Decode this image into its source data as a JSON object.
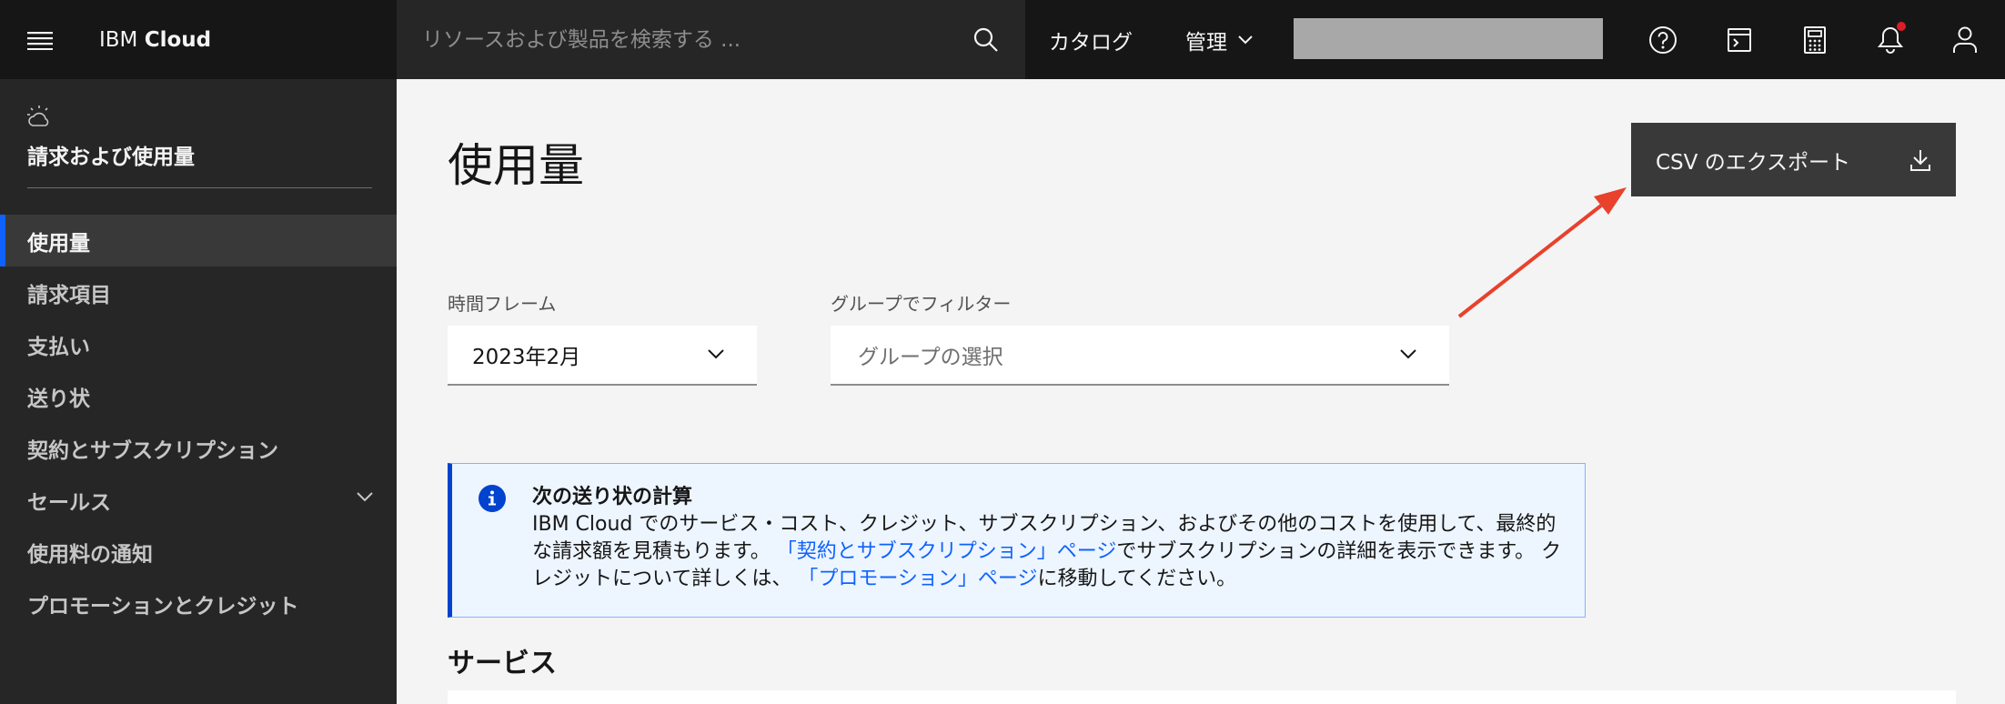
{
  "header": {
    "brand_prefix": "IBM ",
    "brand_strong": "Cloud",
    "search_placeholder": "リソースおよび製品を検索する ...",
    "catalog_label": "カタログ",
    "manage_label": "管理"
  },
  "sidebar": {
    "title": "請求および使用量",
    "items": [
      {
        "label": "使用量",
        "active": true
      },
      {
        "label": "請求項目"
      },
      {
        "label": "支払い"
      },
      {
        "label": "送り状"
      },
      {
        "label": "契約とサブスクリプション"
      },
      {
        "label": "セールス",
        "expandable": true
      },
      {
        "label": "使用料の通知"
      },
      {
        "label": "プロモーションとクレジット"
      }
    ]
  },
  "main": {
    "page_title": "使用量",
    "export_label": "CSV のエクスポート",
    "time_frame_label": "時間フレーム",
    "time_frame_value": "2023年2月",
    "group_filter_label": "グループでフィルター",
    "group_filter_placeholder": "グループの選択",
    "notice": {
      "title": "次の送り状の計算",
      "text_1": "IBM Cloud でのサービス・コスト、クレジット、サブスクリプション、およびその他のコストを使用して、最終的な請求額を見積もります。 ",
      "link_1": "「契約とサブスクリプション」ページ",
      "text_2": "でサブスクリプションの詳細を表示できます。 クレジットについて詳しくは、 ",
      "link_2": "「プロモーション」ページ",
      "text_3": "に移動してください。"
    },
    "services_heading": "サービス"
  },
  "colors": {
    "header_bg": "#161616",
    "sidebar_bg": "#262626",
    "active_indicator": "#0f62fe",
    "notice_bg": "#edf5ff",
    "annotation_arrow": "#e8412c"
  }
}
